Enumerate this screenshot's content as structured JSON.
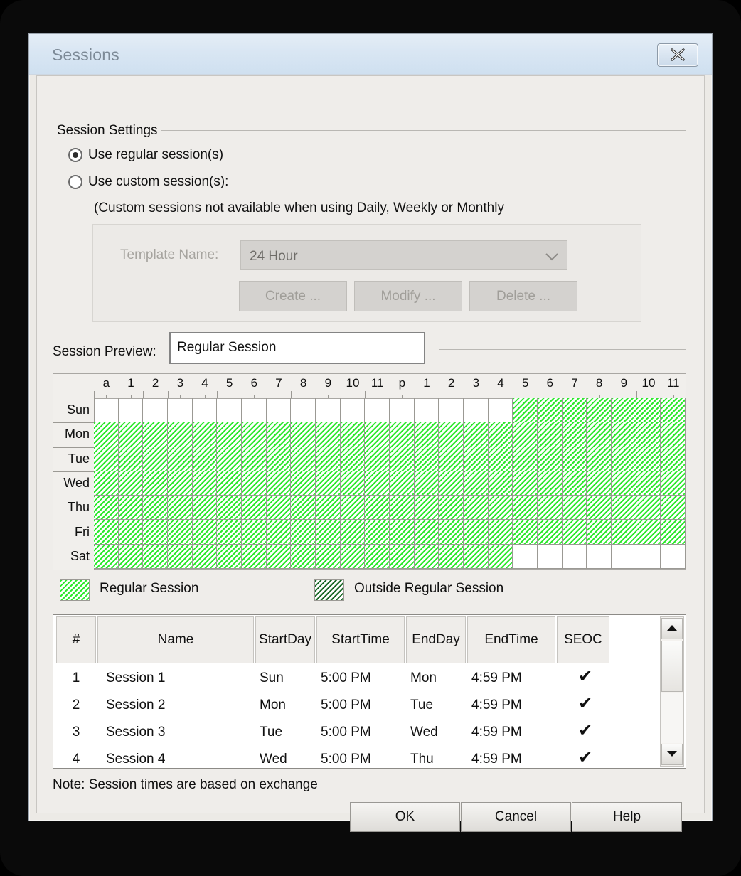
{
  "window": {
    "title": "Sessions",
    "close_icon": "close-x-icon"
  },
  "session_settings": {
    "group_label": "Session Settings",
    "radio_regular": "Use regular session(s)",
    "radio_custom": "Use custom session(s):",
    "selected": "regular",
    "custom_note": "(Custom sessions not available when using Daily, Weekly or Monthly",
    "template": {
      "label": "Template Name:",
      "value": "24 Hour",
      "disabled": true,
      "dropdown_icon": "chevron-down-icon",
      "buttons": [
        "Create ...",
        "Modify ...",
        "Delete ..."
      ]
    }
  },
  "preview": {
    "label": "Session Preview:",
    "value": "Regular Session"
  },
  "schedule": {
    "hour_labels": [
      "a",
      "1",
      "2",
      "3",
      "4",
      "5",
      "6",
      "7",
      "8",
      "9",
      "10",
      "11",
      "p",
      "1",
      "2",
      "3",
      "4",
      "5",
      "6",
      "7",
      "8",
      "9",
      "10",
      "11"
    ],
    "days": [
      "Sun",
      "Mon",
      "Tue",
      "Wed",
      "Thu",
      "Fri",
      "Sat"
    ],
    "session_cells": [
      [
        0,
        0,
        0,
        0,
        0,
        0,
        0,
        0,
        0,
        0,
        0,
        0,
        0,
        0,
        0,
        0,
        0,
        1,
        1,
        1,
        1,
        1,
        1,
        1
      ],
      [
        1,
        1,
        1,
        1,
        1,
        1,
        1,
        1,
        1,
        1,
        1,
        1,
        1,
        1,
        1,
        1,
        1,
        1,
        1,
        1,
        1,
        1,
        1,
        1
      ],
      [
        1,
        1,
        1,
        1,
        1,
        1,
        1,
        1,
        1,
        1,
        1,
        1,
        1,
        1,
        1,
        1,
        1,
        1,
        1,
        1,
        1,
        1,
        1,
        1
      ],
      [
        1,
        1,
        1,
        1,
        1,
        1,
        1,
        1,
        1,
        1,
        1,
        1,
        1,
        1,
        1,
        1,
        1,
        1,
        1,
        1,
        1,
        1,
        1,
        1
      ],
      [
        1,
        1,
        1,
        1,
        1,
        1,
        1,
        1,
        1,
        1,
        1,
        1,
        1,
        1,
        1,
        1,
        1,
        1,
        1,
        1,
        1,
        1,
        1,
        1
      ],
      [
        1,
        1,
        1,
        1,
        1,
        1,
        1,
        1,
        1,
        1,
        1,
        1,
        1,
        1,
        1,
        1,
        1,
        1,
        1,
        1,
        1,
        1,
        1,
        1
      ],
      [
        1,
        1,
        1,
        1,
        1,
        1,
        1,
        1,
        1,
        1,
        1,
        1,
        1,
        1,
        1,
        1,
        1,
        0,
        0,
        0,
        0,
        0,
        0,
        0
      ]
    ]
  },
  "legend": {
    "regular": "Regular Session",
    "outside": "Outside Regular Session",
    "regular_color": "#2ee82e",
    "outside_color": "#1d6b2a"
  },
  "sessions_table": {
    "headers": [
      "#",
      "Name",
      "Start\nDay",
      "Start\nTime",
      "End\nDay",
      "End\nTime",
      "SEOC"
    ],
    "rows": [
      {
        "num": "1",
        "name": "Session  1",
        "start_day": "Sun",
        "start_time": "5:00 PM",
        "end_day": "Mon",
        "end_time": "4:59 PM",
        "seoc": "✔"
      },
      {
        "num": "2",
        "name": "Session  2",
        "start_day": "Mon",
        "start_time": "5:00 PM",
        "end_day": "Tue",
        "end_time": "4:59 PM",
        "seoc": "✔"
      },
      {
        "num": "3",
        "name": "Session  3",
        "start_day": "Tue",
        "start_time": "5:00 PM",
        "end_day": "Wed",
        "end_time": "4:59 PM",
        "seoc": "✔"
      },
      {
        "num": "4",
        "name": "Session  4",
        "start_day": "Wed",
        "start_time": "5:00 PM",
        "end_day": "Thu",
        "end_time": "4:59 PM",
        "seoc": "✔"
      }
    ],
    "scroll_up_icon": "caret-up-icon",
    "scroll_down_icon": "caret-down-icon"
  },
  "note": "Note: Session times are based on exchange",
  "footer": {
    "ok": "OK",
    "cancel": "Cancel",
    "help": "Help"
  }
}
